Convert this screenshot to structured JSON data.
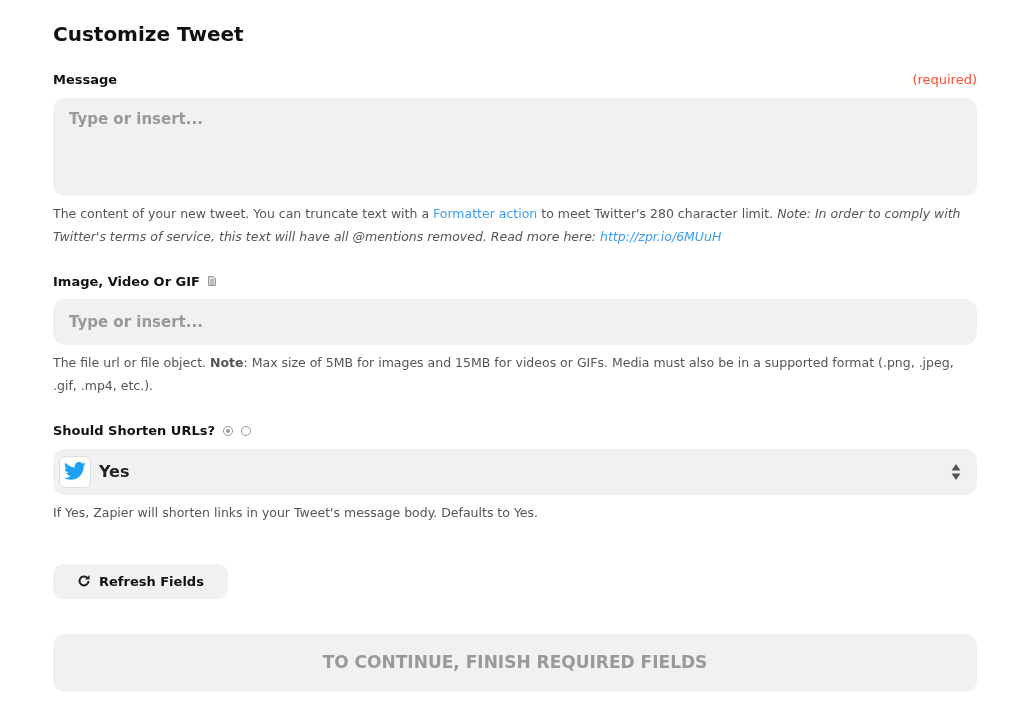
{
  "title": "Customize Tweet",
  "fields": [
    {
      "kind": "textarea",
      "label": "Message",
      "required_label": "(required)",
      "placeholder": "Type or insert...",
      "help": [
        {
          "text": "The content of your new tweet. You can truncate text with a "
        },
        {
          "link": "Formatter action",
          "italic": false
        },
        {
          "text": " to meet Twitter's 280 character limit. *Note: In order to comply with Twitter's terms of service, this text will have all @mentions removed. Read more here:* "
        },
        {
          "link": "http://zpr.io/6MUuH",
          "italic": true
        }
      ]
    },
    {
      "kind": "file",
      "label": "Image, Video Or GIF",
      "placeholder": "Type or insert...",
      "help": [
        {
          "text": "The file url or file object. **Note**: Max size of 5MB for images and 15MB for videos or GIFs. Media must also be in a supported format (.png, .jpeg, .gif, .mp4, etc.)."
        }
      ]
    },
    {
      "kind": "select",
      "label": "Should Shorten URLs?",
      "radios": [
        {
          "selected": true
        },
        {
          "selected": false
        }
      ],
      "value": "Yes",
      "help": [
        {
          "text": "If Yes, Zapier will shorten links in your Tweet's message body. Defaults to Yes."
        }
      ]
    }
  ],
  "refresh_button": "Refresh Fields",
  "continue_button": {
    "label": "TO CONTINUE, FINISH REQUIRED FIELDS",
    "disabled": true
  }
}
